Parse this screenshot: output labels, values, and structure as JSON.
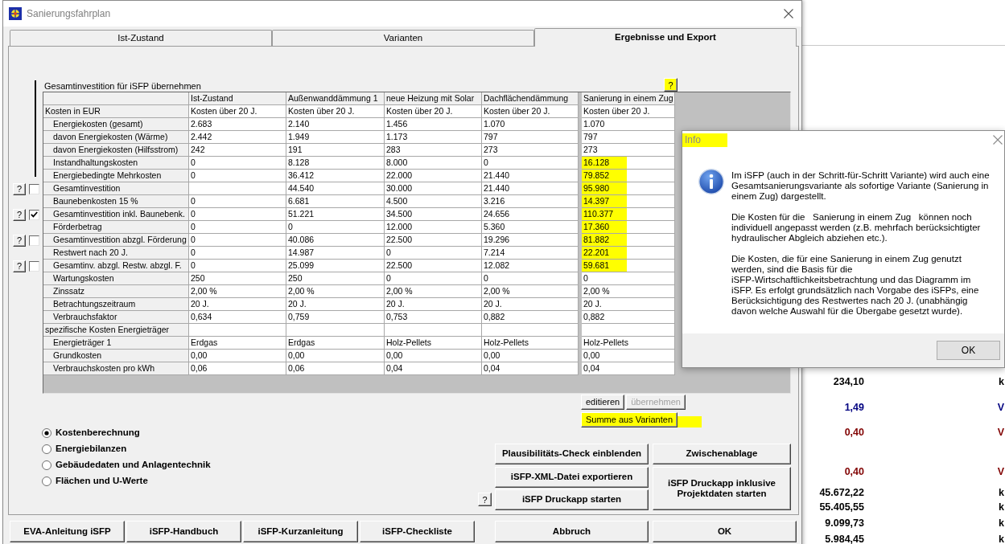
{
  "window": {
    "title": "Sanierungsfahrplan"
  },
  "tabs": [
    {
      "label": "Ist-Zustand",
      "selected": false
    },
    {
      "label": "Varianten",
      "selected": false
    },
    {
      "label": "Ergebnisse und Export",
      "selected": true
    }
  ],
  "transfer_header": {
    "label": "Gesamtinvestition für iSFP übernehmen",
    "help": "?",
    "help_highlighted": true
  },
  "table": {
    "columns": [
      "Ist-Zustand",
      "Außenwanddämmung 1",
      "neue Heizung mit Solar",
      "Dachflächendämmung",
      "Sanierung in einem Zug"
    ],
    "groups": [
      {
        "label": "Kosten in EUR",
        "values": {
          "column_1": "Kosten über 20 J.",
          "column_2": "Kosten über 20 J.",
          "column_3": "Kosten über 20 J.",
          "column_4": "Kosten über 20 J.",
          "column_5": "Kosten über 20 J."
        },
        "children": [
          {
            "label": "Energiekosten (gesamt)",
            "values": {
              "column_1": "2.683",
              "column_2": "2.140",
              "column_3": "1.456",
              "column_4": "1.070",
              "column_5": "1.070"
            },
            "highlighted": false
          },
          {
            "label": "davon Energiekosten (Wärme)",
            "values": {
              "column_1": "2.442",
              "column_2": "1.949",
              "column_3": "1.173",
              "column_4": "797",
              "column_5": "797"
            },
            "highlighted": false
          },
          {
            "label": "davon Energiekosten (Hilfsstrom)",
            "values": {
              "column_1": "242",
              "column_2": "191",
              "column_3": "283",
              "column_4": "273",
              "column_5": "273"
            },
            "highlighted": false
          },
          {
            "label": "Instandhaltungskosten",
            "values": {
              "column_1": "0",
              "column_2": "8.128",
              "column_3": "8.000",
              "column_4": "0",
              "column_5": "16.128"
            },
            "highlighted": true
          },
          {
            "label": "Energiebedingte Mehrkosten",
            "values": {
              "column_1": "0",
              "column_2": "36.412",
              "column_3": "22.000",
              "column_4": "21.440",
              "column_5": "79.852"
            },
            "highlighted": true
          },
          {
            "label": "Gesamtinvestition",
            "values": {
              "column_2": "44.540",
              "column_3": "30.000",
              "column_4": "21.440",
              "column_5": "95.980"
            },
            "highlighted": true,
            "transfer": {
              "help": "?",
              "checked": false
            }
          },
          {
            "label": "Baunebenkosten 15 %",
            "values": {
              "column_1": "0",
              "column_2": "6.681",
              "column_3": "4.500",
              "column_4": "3.216",
              "column_5": "14.397"
            },
            "highlighted": true
          },
          {
            "label": "Gesamtinvestition inkl. Baunebenk.",
            "values": {
              "column_1": "0",
              "column_2": "51.221",
              "column_3": "34.500",
              "column_4": "24.656",
              "column_5": "110.377"
            },
            "highlighted": true,
            "transfer": {
              "help": "?",
              "checked": true
            }
          },
          {
            "label": "Förderbetrag",
            "values": {
              "column_1": "0",
              "column_2": "0",
              "column_3": "12.000",
              "column_4": "5.360",
              "column_5": "17.360"
            },
            "highlighted": true
          },
          {
            "label": "Gesamtinvestition abzgl. Förderung",
            "values": {
              "column_1": "0",
              "column_2": "40.086",
              "column_3": "22.500",
              "column_4": "19.296",
              "column_5": "81.882"
            },
            "highlighted": true,
            "transfer": {
              "help": "?",
              "checked": false
            }
          },
          {
            "label": "Restwert nach 20 J.",
            "values": {
              "column_1": "0",
              "column_2": "14.987",
              "column_3": "0",
              "column_4": "7.214",
              "column_5": "22.201"
            },
            "highlighted": true
          },
          {
            "label": "Gesamtinv. abzgl. Restw. abzgl. F.",
            "values": {
              "column_1": "0",
              "column_2": "25.099",
              "column_3": "22.500",
              "column_4": "12.082",
              "column_5": "59.681"
            },
            "highlighted": true,
            "transfer": {
              "help": "?",
              "checked": false
            }
          },
          {
            "label": "Wartungskosten",
            "values": {
              "column_1": "250",
              "column_2": "250",
              "column_3": "0",
              "column_4": "0",
              "column_5": "0"
            },
            "highlighted": false
          },
          {
            "label": "Zinssatz",
            "values": {
              "column_1": "2,00 %",
              "column_2": "2,00 %",
              "column_3": "2,00 %",
              "column_4": "2,00 %",
              "column_5": "2,00 %"
            },
            "highlighted": false
          },
          {
            "label": "Betrachtungszeitraum",
            "values": {
              "column_1": "20 J.",
              "column_2": "20 J.",
              "column_3": "20 J.",
              "column_4": "20 J.",
              "column_5": "20 J."
            },
            "highlighted": false
          },
          {
            "label": "Verbrauchsfaktor",
            "values": {
              "column_1": "0,634",
              "column_2": "0,759",
              "column_3": "0,753",
              "column_4": "0,882",
              "column_5": "0,882"
            },
            "highlighted": false
          }
        ]
      },
      {
        "label": "spezifische Kosten Energieträger",
        "children": [
          {
            "label": "Energieträger 1",
            "values": {
              "column_1": "Erdgas",
              "column_2": "Erdgas",
              "column_3": "Holz-Pellets",
              "column_4": "Holz-Pellets",
              "column_5": "Holz-Pellets"
            },
            "highlighted": false
          },
          {
            "label": "Grundkosten",
            "values": {
              "column_1": "0,00",
              "column_2": "0,00",
              "column_3": "0,00",
              "column_4": "0,00",
              "column_5": "0,00"
            },
            "highlighted": false
          },
          {
            "label": "Verbrauchskosten pro kWh",
            "values": {
              "column_1": "0,06",
              "column_2": "0,06",
              "column_3": "0,04",
              "column_4": "0,04",
              "column_5": "0,04"
            },
            "highlighted": false
          }
        ]
      }
    ]
  },
  "grid_actions": [
    {
      "label": "editieren",
      "disabled": false
    },
    {
      "label": "übernehmen",
      "disabled": true
    }
  ],
  "sum_button": {
    "label": "Summe aus Varianten",
    "highlighted": true
  },
  "view_options": [
    {
      "label": "Kostenberechnung",
      "selected": true
    },
    {
      "label": "Energiebilanzen",
      "selected": false
    },
    {
      "label": "Gebäudedaten und Anlagentechnik",
      "selected": false
    },
    {
      "label": "Flächen und U-Werte",
      "selected": false
    }
  ],
  "export_actions": {
    "help": "?",
    "left": [
      "Plausibilitäts-Check einblenden",
      "iSFP-XML-Datei exportieren",
      "iSFP Druckapp starten"
    ],
    "right": [
      "Zwischenablage",
      "iSFP Druckapp inklusive Projektdaten starten"
    ]
  },
  "footer_buttons": [
    "EVA-Anleitung iSFP",
    "iSFP-Handbuch",
    "iSFP-Kurzanleitung",
    "iSFP-Checkliste"
  ],
  "dialog_buttons": [
    "Abbruch",
    "OK"
  ],
  "info_dialog": {
    "title": "Info",
    "title_highlighted": true,
    "paragraphs": [
      "Im iSFP (auch in der Schritt-für-Schritt Variante) wird auch eine Gesamtsanierungsvariante als sofortige Variante (Sanierung in einem Zug) dargestellt.",
      "Die Kosten für die   Sanierung in einem Zug   können noch individuell angepasst werden (z.B. mehrfach berücksichtigter hydraulischer Abgleich abziehen etc.).",
      "Die Kosten, die für eine Sanierung in einem Zug genutzt werden, sind die Basis für die iSFP-Wirtschaftlichkeitsbetrachtung und das Diagramm im iSFP. Es erfolgt grundsätzlich nach Vorgabe des iSFPs, eine Berücksichtigung des Restwertes nach 20 J. (unabhängig davon welche Auswahl für die Übergabe gesetzt wurde)."
    ],
    "button": "OK"
  },
  "background_window": {
    "rows": [
      {
        "value": "234,10",
        "unit": "k",
        "color": "#000000"
      },
      {
        "value": "1,49",
        "unit": "V",
        "color": "#000080"
      },
      {
        "value": "0,40",
        "unit": "V",
        "color": "#800000"
      },
      {
        "value": "0,40",
        "unit": "V",
        "color": "#800000"
      },
      {
        "value": "45.672,22",
        "unit": "k",
        "color": "#000000"
      },
      {
        "value": "55.405,55",
        "unit": "k",
        "color": "#000000"
      },
      {
        "value": "9.099,73",
        "unit": "k",
        "color": "#000000"
      },
      {
        "value": "5.984,45",
        "unit": "k",
        "color": "#000000"
      }
    ]
  }
}
